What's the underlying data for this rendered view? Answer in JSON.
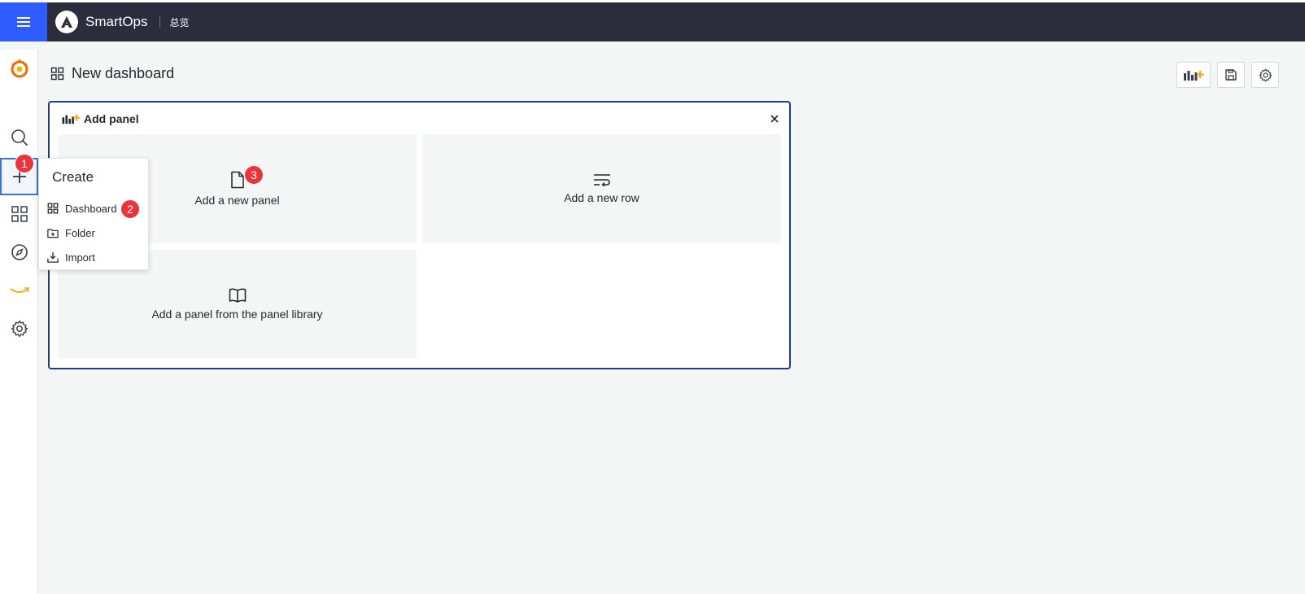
{
  "topbar": {
    "brand_name": "SmartOps",
    "brand_sub": "总览"
  },
  "dashboard": {
    "title": "New dashboard"
  },
  "add_panel": {
    "title": "Add panel",
    "tiles": {
      "new_panel": "Add a new panel",
      "new_row": "Add a new row",
      "library": "Add a panel from the panel library"
    }
  },
  "create_menu": {
    "title": "Create",
    "items": [
      "Dashboard",
      "Folder",
      "Import"
    ]
  },
  "badges": [
    "1",
    "2",
    "3"
  ],
  "icons": {
    "sidebar": [
      "grafana-logo-icon",
      "search-icon",
      "plus-icon",
      "dashboards-icon",
      "explore-icon",
      "amazon-icon",
      "settings-gear-icon"
    ],
    "toolbar": [
      "add-panel-icon",
      "save-icon",
      "settings-gear-icon"
    ]
  },
  "colors": {
    "topbar_bg": "#2b2d3c",
    "menu_button": "#2f5cff",
    "badge": "#e8343a",
    "card_border": "#1f3d8f",
    "grafana_orange": "#f46800"
  }
}
